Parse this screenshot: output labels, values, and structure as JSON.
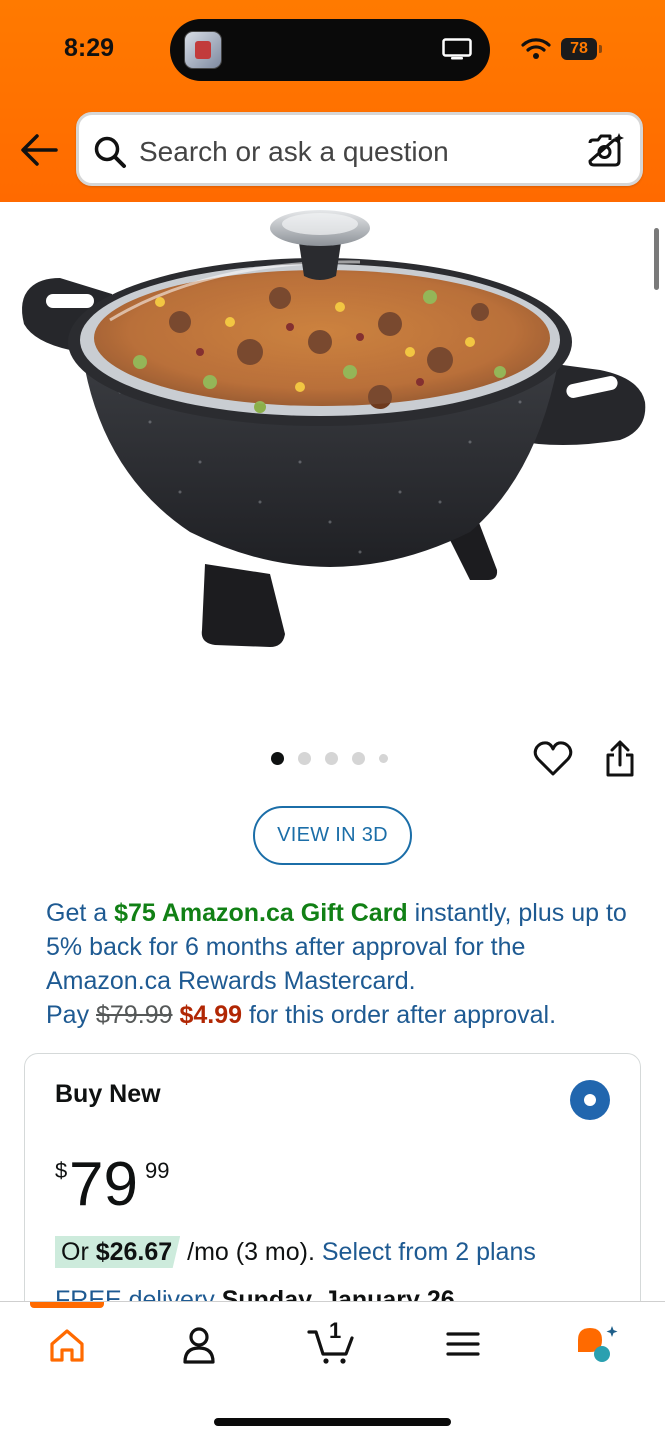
{
  "status_bar": {
    "time": "8:29",
    "battery": "78"
  },
  "header": {
    "search_placeholder": "Search or ask a question",
    "icons": [
      "back-arrow-icon",
      "search-icon",
      "camera-icon"
    ]
  },
  "product": {
    "image_alt": "Electric skillet with glass lid filled with soup",
    "pager": {
      "count": 5,
      "active": 0
    },
    "view_3d_label": "VIEW IN 3D"
  },
  "promo": {
    "part1": "Get a ",
    "gift": "$75 Amazon.ca Gift Card",
    "part2": " instantly, plus up to 5% back for 6 months after approval for the Amazon.ca Rewards Mastercard.",
    "pay_prefix": "Pay ",
    "old_price": "$79.99",
    "new_price": "$4.99",
    "pay_suffix": " for this order after approval."
  },
  "buy_box": {
    "title": "Buy New",
    "price_currency": "$",
    "price_whole": "79",
    "price_fraction": "99",
    "installment_prefix": "Or ",
    "installment_amount": "$26.67",
    "installment_suffix": " /mo (3 mo). ",
    "plans_link": "Select from 2 plans",
    "delivery_prefix": "FREE delivery ",
    "delivery_date": "Sunday, January 26"
  },
  "bottom_nav": {
    "active": "home",
    "items": [
      "home-icon",
      "account-icon",
      "cart-icon",
      "menu-icon",
      "rufus-icon"
    ],
    "cart_count": "1"
  },
  "colors": {
    "header_orange": "#ff6f00",
    "link_blue": "#1e5a92",
    "promo_green": "#118015",
    "price_red": "#b12704",
    "radio_blue": "#2166ae"
  }
}
